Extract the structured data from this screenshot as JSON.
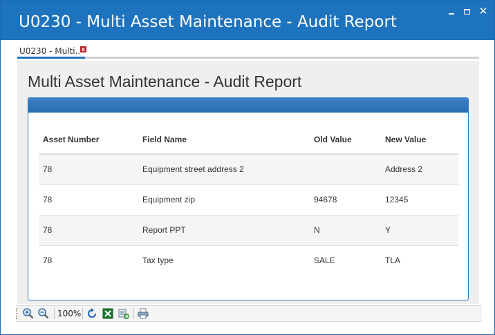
{
  "window": {
    "title": "U0230 - Multi Asset Maintenance - Audit Report",
    "minimize_label": "minimize",
    "maximize_label": "maximize",
    "close_glyph": "✕"
  },
  "tab": {
    "label": "U0230 - Multi..",
    "close_glyph": "x"
  },
  "page": {
    "title": "Multi Asset Maintenance - Audit Report"
  },
  "table": {
    "headers": [
      "Asset Number",
      "Field Name",
      "Old Value",
      "New Value"
    ],
    "rows": [
      [
        "78",
        "Equipment street address 2",
        "",
        "Address 2"
      ],
      [
        "78",
        "Equipment zip",
        "94678",
        "12345"
      ],
      [
        "78",
        "Report PPT",
        "N",
        "Y"
      ],
      [
        "78",
        "Tax type",
        "SALE",
        "TLA"
      ]
    ]
  },
  "toolbar": {
    "zoom_level": "100%",
    "icons": [
      "zoom-in-icon",
      "zoom-out-icon",
      "refresh-icon",
      "excel-export-icon",
      "export-icon",
      "print-icon"
    ]
  },
  "colors": {
    "title_bar": "#1e73be",
    "card_header": "#2d72b8",
    "tab_close": "#b3262b"
  }
}
